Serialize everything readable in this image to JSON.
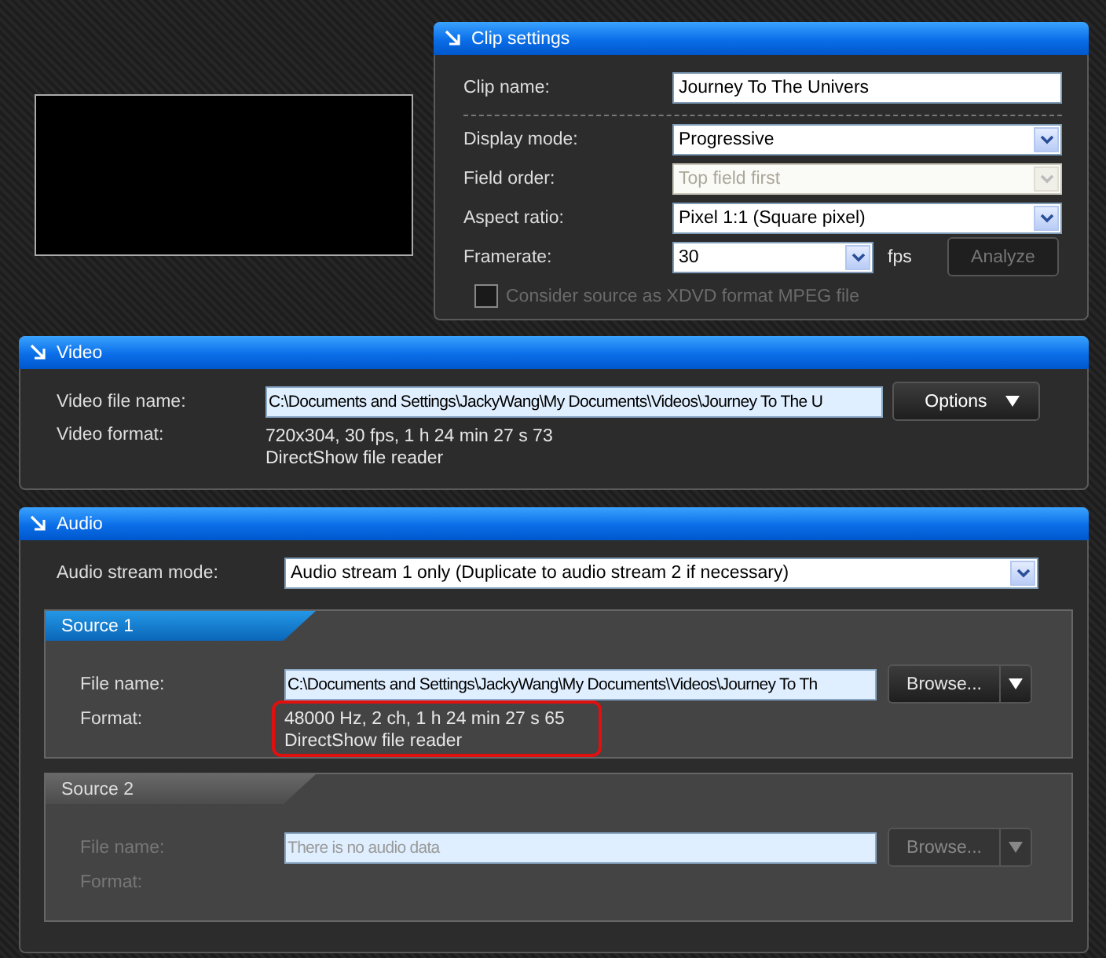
{
  "clip_settings": {
    "title": "Clip settings",
    "name_row": {
      "label": "Clip name:",
      "value": "Journey To The Univers"
    },
    "rows": [
      {
        "label": "Display mode:",
        "value": "Progressive",
        "disabled": false
      },
      {
        "label": "Field order:",
        "value": "Top field first",
        "disabled": true
      },
      {
        "label": "Aspect ratio:",
        "value": "Pixel 1:1 (Square pixel)",
        "disabled": false
      }
    ],
    "framerate": {
      "label": "Framerate:",
      "value": "30",
      "unit": "fps"
    },
    "analyze_button": {
      "label": "Analyze",
      "disabled": true
    },
    "xdvd_checkbox": {
      "label": "Consider source as XDVD format MPEG file",
      "checked": false,
      "disabled": true
    }
  },
  "video": {
    "title": "Video",
    "file_label": "Video file name:",
    "file_value": "C:\\Documents and Settings\\JackyWang\\My Documents\\Videos\\Journey To The U",
    "options_button": "Options",
    "format_label": "Video format:",
    "format_lines": [
      "720x304,  30  fps,  1 h 24 min 27 s 73",
      "DirectShow file reader"
    ]
  },
  "audio": {
    "title": "Audio",
    "stream_label": "Audio stream mode:",
    "stream_value": "Audio stream 1 only (Duplicate to audio stream 2 if necessary)",
    "sources": [
      {
        "title": "Source 1",
        "disabled": false,
        "file_label": "File name:",
        "file_value": "C:\\Documents and Settings\\JackyWang\\My Documents\\Videos\\Journey To Th",
        "browse_button": "Browse...",
        "format_label": "Format:",
        "format_lines": [
          "48000  Hz,  2  ch,  1 h 24 min 27 s 65",
          "DirectShow file reader"
        ],
        "highlighted": true
      },
      {
        "title": "Source 2",
        "disabled": true,
        "file_label": "File name:",
        "file_placeholder": "There is no audio data",
        "browse_button": "Browse...",
        "format_label": "Format:"
      }
    ]
  }
}
